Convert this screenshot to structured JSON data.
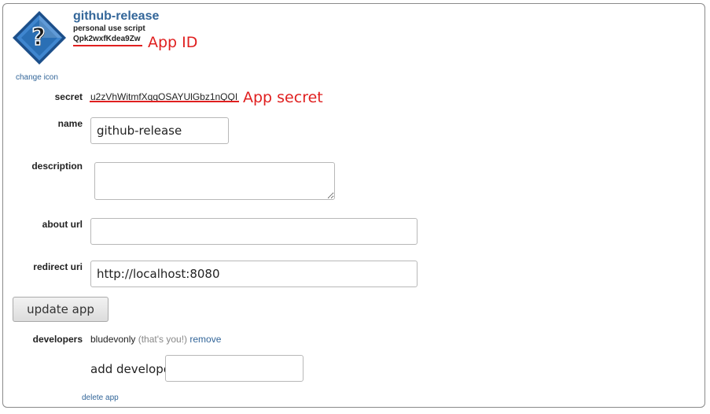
{
  "app": {
    "title": "github-release",
    "subtitle": "personal use script",
    "app_id": "Qpk2wxfKdea9Zw",
    "app_id_annotation": "App ID",
    "change_icon": "change icon"
  },
  "secret": {
    "label": "secret",
    "value": "u2zVhWitmfXqqOSAYUlGbz1nQQI",
    "annotation": "App secret"
  },
  "fields": {
    "name_label": "name",
    "name_value": "github-release",
    "description_label": "description",
    "description_value": "",
    "about_url_label": "about url",
    "about_url_value": "",
    "redirect_uri_label": "redirect uri",
    "redirect_uri_value": "http://localhost:8080"
  },
  "update_button": "update app",
  "developers": {
    "label": "developers",
    "name": "bludevonly",
    "thats_you": "(that's you!)",
    "remove": "remove",
    "add_label": "add developer:",
    "add_value": ""
  },
  "delete_app": "delete app",
  "colors": {
    "link": "#336699",
    "annotation": "#e02020",
    "icon_blue": "#2a6fb5"
  }
}
